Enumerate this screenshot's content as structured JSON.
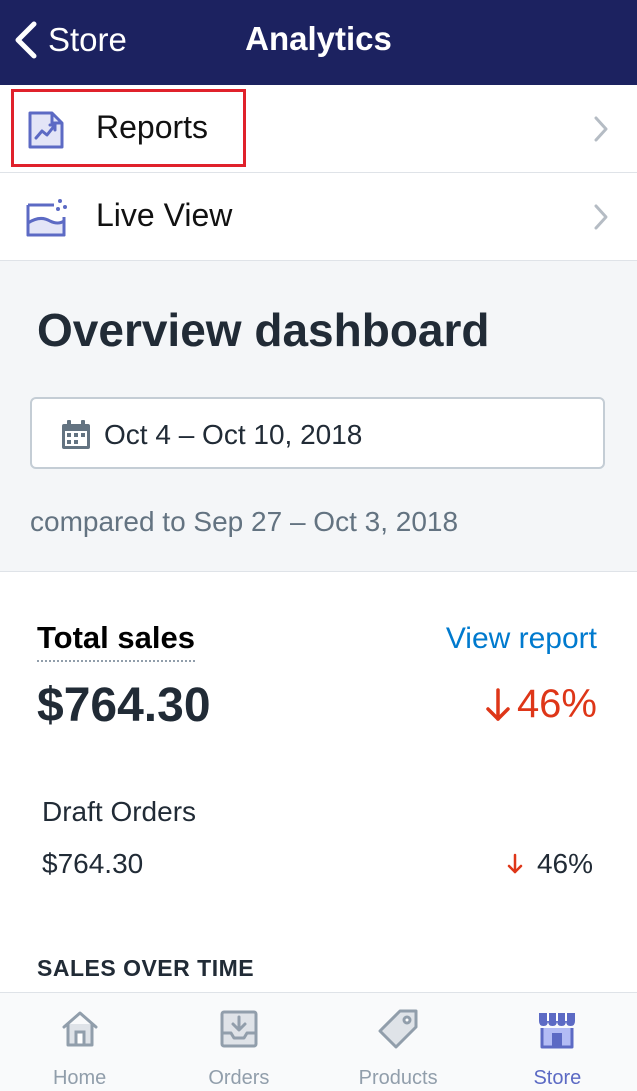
{
  "navbar": {
    "back_label": "Store",
    "title": "Analytics"
  },
  "menu": {
    "items": [
      {
        "label": "Reports",
        "icon": "reports-icon"
      },
      {
        "label": "Live View",
        "icon": "live-view-icon"
      }
    ]
  },
  "overview": {
    "title": "Overview dashboard",
    "date_range": "Oct 4 – Oct 10, 2018",
    "compared": "compared to Sep 27 – Oct 3, 2018"
  },
  "sales": {
    "total_label": "Total sales",
    "view_report": "View report",
    "total_value": "$764.30",
    "total_change": "46%",
    "draft_label": "Draft Orders",
    "draft_value": "$764.30",
    "draft_change": "46%",
    "section_heading": "SALES OVER TIME"
  },
  "tabbar": {
    "tabs": [
      {
        "label": "Home",
        "icon": "home-icon"
      },
      {
        "label": "Orders",
        "icon": "orders-icon"
      },
      {
        "label": "Products",
        "icon": "products-icon"
      },
      {
        "label": "Store",
        "icon": "store-icon",
        "active": true
      }
    ]
  },
  "colors": {
    "navbar": "#1c2260",
    "accent": "#5c6ac4",
    "link": "#007ace",
    "negative": "#de3618",
    "highlight": "#e0212b"
  }
}
